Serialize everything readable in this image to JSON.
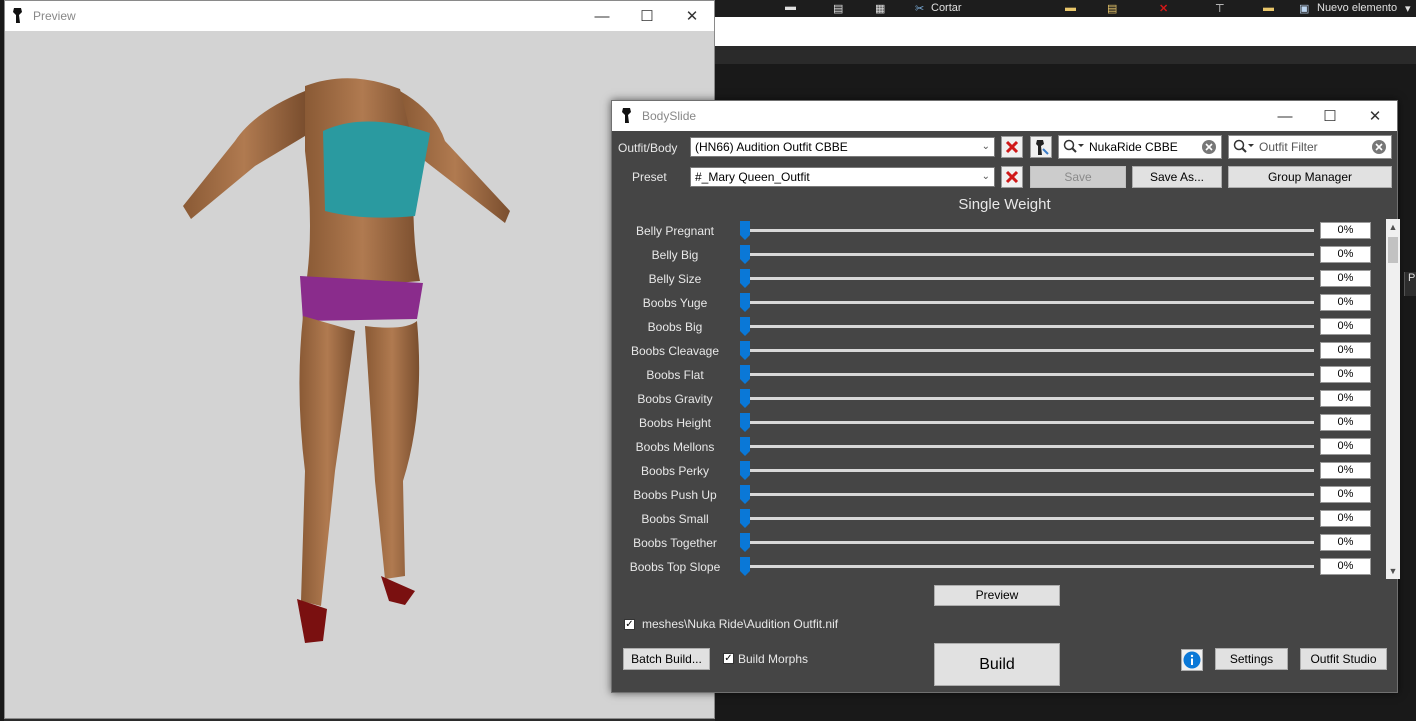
{
  "background": {
    "ribbon": {
      "cut_label": "Cortar",
      "new_item_label": "Nuevo elemento"
    },
    "side_tab_label": "P"
  },
  "preview_window": {
    "title": "Preview",
    "controls": {
      "minimize": "—",
      "maximize": "☐",
      "close": "✕"
    }
  },
  "bodyslide": {
    "title": "BodySlide",
    "controls": {
      "minimize": "—",
      "maximize": "☐",
      "close": "✕"
    },
    "outfit_label": "Outfit/Body",
    "outfit_value": "(HN66) Audition Outfit CBBE",
    "preset_label": "Preset",
    "preset_value": "#_Mary Queen_Outfit",
    "group_filter_value": "NukaRide CBBE",
    "outfit_filter_placeholder": "Outfit Filter",
    "save_label": "Save",
    "save_as_label": "Save As...",
    "group_manager_label": "Group Manager",
    "section_title": "Single Weight",
    "sliders": [
      {
        "name": "Belly Pregnant",
        "value": "0%"
      },
      {
        "name": "Belly Big",
        "value": "0%"
      },
      {
        "name": "Belly Size",
        "value": "0%"
      },
      {
        "name": "Boobs Yuge",
        "value": "0%"
      },
      {
        "name": "Boobs Big",
        "value": "0%"
      },
      {
        "name": "Boobs Cleavage",
        "value": "0%"
      },
      {
        "name": "Boobs Flat",
        "value": "0%"
      },
      {
        "name": "Boobs Gravity",
        "value": "0%"
      },
      {
        "name": "Boobs Height",
        "value": "0%"
      },
      {
        "name": "Boobs Mellons",
        "value": "0%"
      },
      {
        "name": "Boobs Perky",
        "value": "0%"
      },
      {
        "name": "Boobs Push Up",
        "value": "0%"
      },
      {
        "name": "Boobs Small",
        "value": "0%"
      },
      {
        "name": "Boobs Together",
        "value": "0%"
      },
      {
        "name": "Boobs Top Slope",
        "value": "0%"
      }
    ],
    "preview_button": "Preview",
    "mesh_path": "meshes\\Nuka Ride\\Audition Outfit.nif",
    "batch_build_label": "Batch Build...",
    "build_morphs_label": "Build Morphs",
    "build_label": "Build",
    "settings_label": "Settings",
    "outfit_studio_label": "Outfit Studio"
  },
  "colors": {
    "accent": "#0a78d7",
    "delete_red": "#d01818",
    "panel": "#454545"
  }
}
